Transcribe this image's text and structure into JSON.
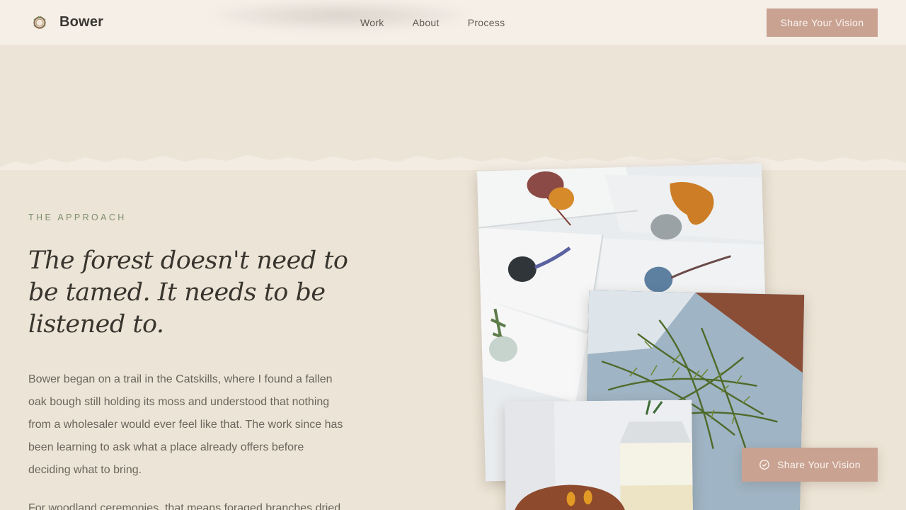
{
  "header": {
    "brand": "Bower",
    "logo_icon": "wreath-icon",
    "nav": [
      "Work",
      "About",
      "Process"
    ],
    "cta_label": "Share Your Vision"
  },
  "approach": {
    "eyebrow": "THE APPROACH",
    "headline": "The forest doesn't need to be tamed. It needs to be listened to.",
    "paragraph_1": "Bower began on a trail in the Catskills, where I found a fallen oak bough still holding its moss and understood that nothing from a wholesaler would ever feel like that. The work since has been learning to ask what a place already offers before deciding what to bring.",
    "paragraph_2": "For woodland ceremonies, that means foraged branches dried"
  },
  "photos": [
    "wax-seal-envelopes-photo",
    "rosemary-sprigs-photo",
    "candle-and-bowl-photo"
  ],
  "floating_cta": {
    "label": "Share Your Vision",
    "icon": "check-circle-icon"
  },
  "colors": {
    "background": "#ece4d6",
    "header": "#f5efe8",
    "accent": "#c9a292",
    "eyebrow": "#7e8e6f"
  }
}
